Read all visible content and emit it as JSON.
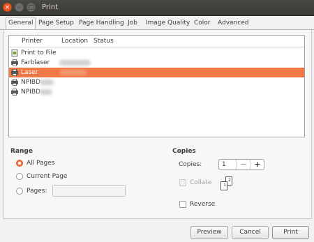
{
  "window": {
    "title": "Print",
    "close_glyph": "×",
    "min_glyph": "–",
    "max_glyph": "□"
  },
  "tabs": [
    "General",
    "Page Setup",
    "Page Handling",
    "Job",
    "Image Quality",
    "Color",
    "Advanced"
  ],
  "printer_list": {
    "columns": [
      "Printer",
      "Location",
      "Status"
    ],
    "rows": [
      {
        "name": "Print to File",
        "icon": "file-printer-icon",
        "selected": false
      },
      {
        "name": "Farblaser",
        "icon": "printer-icon",
        "selected": false
      },
      {
        "name": "Laser",
        "icon": "printer-icon",
        "selected": true
      },
      {
        "name": "NPIBD",
        "icon": "printer-icon",
        "selected": false
      },
      {
        "name": "NPIBD",
        "icon": "printer-icon",
        "selected": false
      }
    ],
    "selection_color": "#f07746"
  },
  "range": {
    "title": "Range",
    "options": [
      "All Pages",
      "Current Page",
      "Pages:"
    ],
    "selected": "All Pages",
    "pages_value": ""
  },
  "copies": {
    "title": "Copies",
    "label": "Copies:",
    "value": "1",
    "minus": "−",
    "plus": "+",
    "collate_label": "Collate",
    "collate_checked": false,
    "collate_disabled": true,
    "collate_pages": [
      "2",
      "1"
    ],
    "reverse_label": "Reverse",
    "reverse_checked": false
  },
  "buttons": {
    "preview": "Preview",
    "cancel": "Cancel",
    "print": "Print"
  }
}
